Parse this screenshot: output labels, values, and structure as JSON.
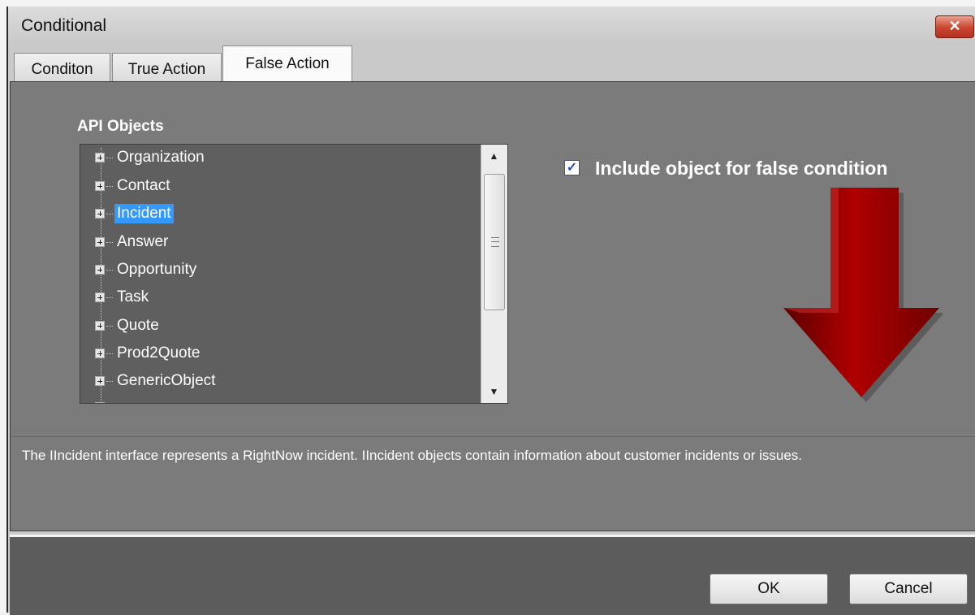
{
  "window": {
    "title": "Conditional"
  },
  "tabs": [
    {
      "label": "Conditon",
      "active": false
    },
    {
      "label": "True Action",
      "active": false
    },
    {
      "label": "False Action",
      "active": true
    }
  ],
  "api_objects": {
    "label": "API Objects",
    "items": [
      {
        "label": "Organization",
        "selected": false
      },
      {
        "label": "Contact",
        "selected": false
      },
      {
        "label": "Incident",
        "selected": true
      },
      {
        "label": "Answer",
        "selected": false
      },
      {
        "label": "Opportunity",
        "selected": false
      },
      {
        "label": "Task",
        "selected": false
      },
      {
        "label": "Quote",
        "selected": false
      },
      {
        "label": "Prod2Quote",
        "selected": false
      },
      {
        "label": "GenericObject",
        "selected": false
      }
    ]
  },
  "include_checkbox": {
    "label": "Include object for false condition",
    "checked": true
  },
  "description": "The IIncident interface represents a RightNow incident. IIncident objects contain information about customer incidents or issues.",
  "buttons": {
    "ok": "OK",
    "cancel": "Cancel"
  },
  "colors": {
    "selection": "#3399ff",
    "arrow": "#8b0000",
    "close": "#c8442e"
  }
}
